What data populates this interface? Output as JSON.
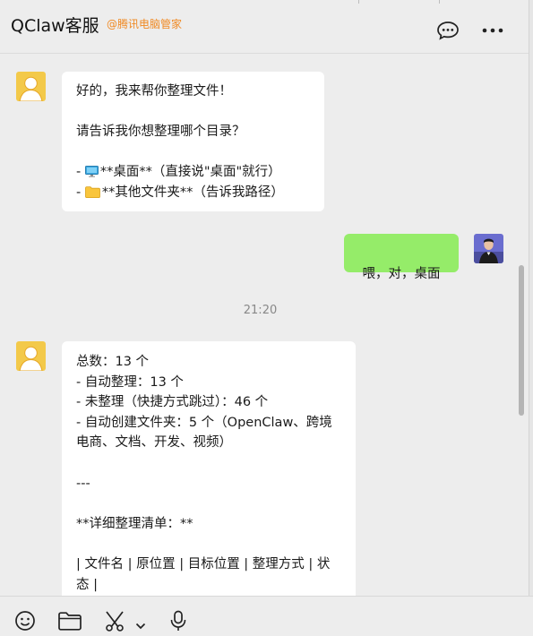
{
  "header": {
    "title": "QClaw客服",
    "org": "@腾讯电脑管家"
  },
  "icons": {
    "chat": "chat-bubble-icon",
    "more": "more-dots-icon",
    "emoji": "emoji-icon",
    "folder": "folder-icon",
    "scissors": "scissors-icon",
    "chevron": "chevron-down-icon",
    "mic": "microphone-icon"
  },
  "colors": {
    "background": "#ededed",
    "bubble_received": "#ffffff",
    "bubble_sent": "#95ec69",
    "org_tag": "#f08a24",
    "bot_avatar": "#f3c94a"
  },
  "messages": [
    {
      "from": "bot",
      "lines": [
        "好的，我来帮你整理文件！",
        "",
        "请告诉我你想整理哪个目录？",
        "",
        "- ",
        "**桌面**（直接说\"桌面\"就行）",
        "- ",
        "**其他文件夹**（告诉我路径）"
      ]
    },
    {
      "from": "user",
      "text": "喂，对，桌面"
    },
    {
      "from": "time",
      "text": "21:20"
    },
    {
      "from": "bot",
      "text": "总数：13 个\n- 自动整理：13 个\n- 未整理（快捷方式跳过）：46 个\n- 自动创建文件夹：5 个（OpenClaw、跨境电商、文档、开发、视频）\n\n---\n\n**详细整理清单：**\n\n| 文件名 | 原位置 | 目标位置 | 整理方式 | 状态 |"
    }
  ]
}
